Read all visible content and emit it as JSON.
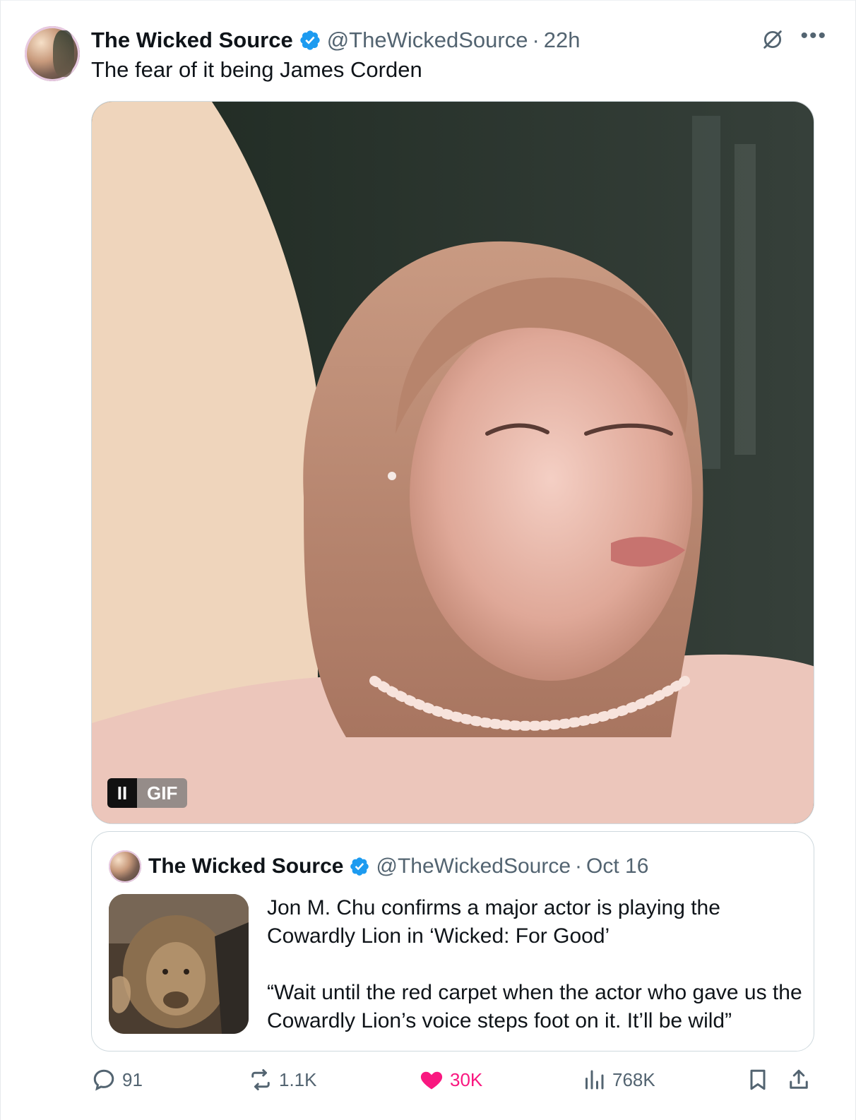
{
  "tweet": {
    "author_name": "The Wicked Source",
    "handle": "@TheWickedSource",
    "separator": "·",
    "time": "22h",
    "text": "The fear of it being James Corden",
    "media": {
      "type": "GIF",
      "gif_label": "GIF",
      "pause_label": "II"
    }
  },
  "quoted_tweet": {
    "author_name": "The Wicked Source",
    "handle": "@TheWickedSource",
    "separator": "·",
    "date": "Oct 16",
    "text_line1": "Jon M. Chu confirms a major actor is playing the Cowardly Lion in ‘Wicked: For Good’",
    "text_line2": "“Wait until the red carpet when the actor who gave us the Cowardly Lion’s voice steps foot on it. It’ll be wild”"
  },
  "actions": {
    "replies": "91",
    "reposts": "1.1K",
    "likes": "30K",
    "views": "768K"
  },
  "colors": {
    "verified": "#1d9bf0",
    "like": "#f91880",
    "secondary_text": "#536471",
    "border": "#cfd9de"
  },
  "icons": [
    "grok-icon",
    "more-icon",
    "verified-badge-icon",
    "reply-icon",
    "repost-icon",
    "like-icon",
    "views-icon",
    "bookmark-icon",
    "share-icon"
  ]
}
